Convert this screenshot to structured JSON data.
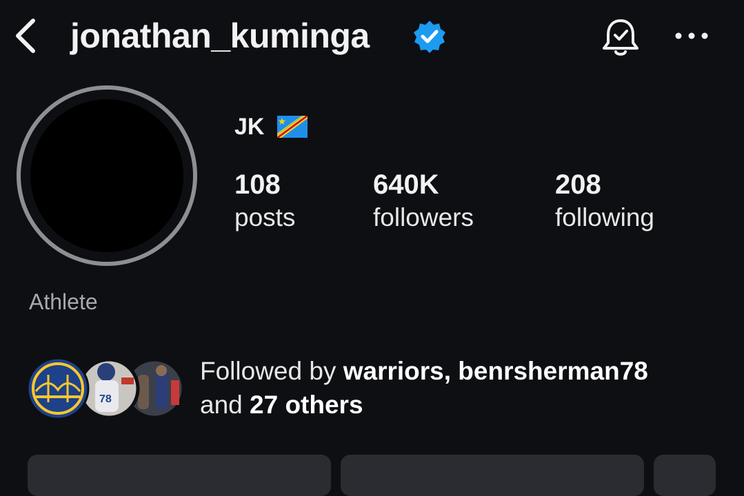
{
  "header": {
    "username": "jonathan_kuminga",
    "verified": true,
    "back_icon": "chevron-left-icon",
    "notification_icon": "bell-check-icon",
    "more_icon": "more-horizontal-icon"
  },
  "profile": {
    "display_name": "JK",
    "flag_icon": "flag-dr-congo-icon",
    "category": "Athlete",
    "stats": [
      {
        "value": "108",
        "label": "posts"
      },
      {
        "value": "640K",
        "label": "followers"
      },
      {
        "value": "208",
        "label": "following"
      }
    ]
  },
  "mutual": {
    "prefix": "Followed by ",
    "user1": "warriors",
    "separator": ", ",
    "user2": "benrsherman78",
    "and": "and ",
    "others": "27 others"
  },
  "colors": {
    "background": "#0d0f13",
    "verified_blue": "#1d9bf0",
    "warriors_blue": "#1d428a",
    "warriors_gold": "#ffc72c"
  }
}
